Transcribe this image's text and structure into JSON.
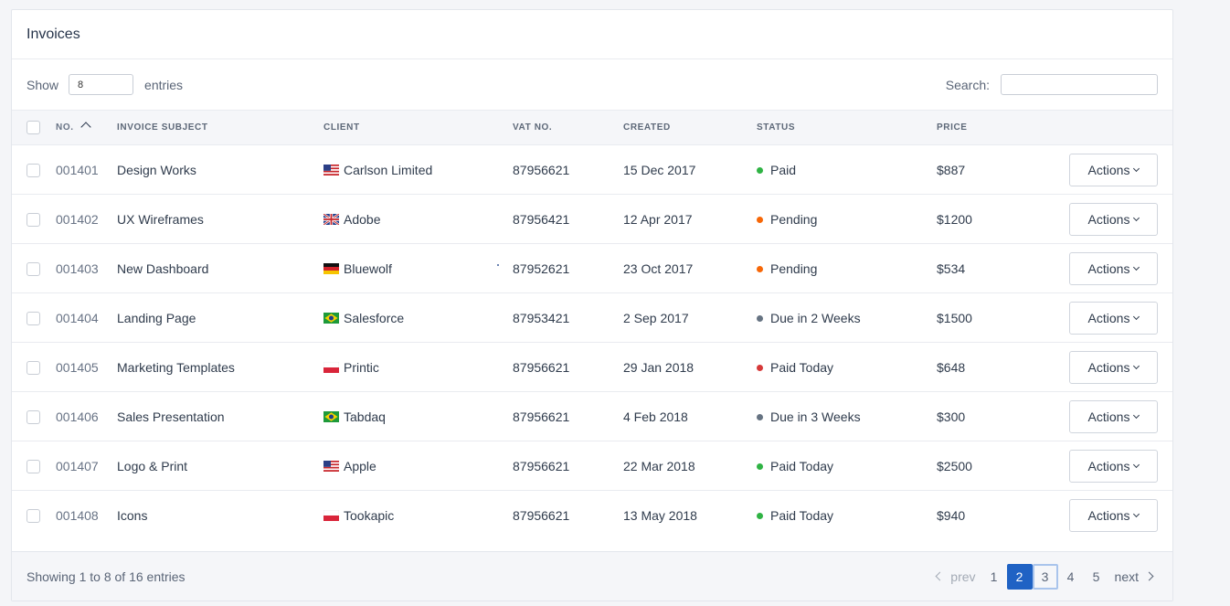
{
  "card": {
    "title": "Invoices"
  },
  "controls": {
    "show_label": "Show",
    "show_value": "8",
    "entries_label": "entries",
    "search_label": "Search:",
    "search_value": ""
  },
  "table": {
    "headers": {
      "no": "No.",
      "subject": "Invoice Subject",
      "client": "Client",
      "vat": "VAT No.",
      "created": "Created",
      "status": "Status",
      "price": "Price"
    },
    "action_label": "Actions",
    "rows": [
      {
        "no": "001401",
        "subject": "Design Works",
        "flag": "us-flag-icon",
        "client": "Carlson Limited",
        "vat": "87956621",
        "created": "15 Dec 2017",
        "status": "Paid",
        "status_color": "#2fb344",
        "price": "$887"
      },
      {
        "no": "001402",
        "subject": "UX Wireframes",
        "flag": "uk-flag-icon",
        "client": "Adobe",
        "vat": "87956421",
        "created": "12 Apr 2017",
        "status": "Pending",
        "status_color": "#f76707",
        "price": "$1200"
      },
      {
        "no": "001403",
        "subject": "New Dashboard",
        "flag": "de-flag-icon",
        "client": "Bluewolf",
        "vat": "87952621",
        "created": "23 Oct 2017",
        "status": "Pending",
        "status_color": "#f76707",
        "price": "$534"
      },
      {
        "no": "001404",
        "subject": "Landing Page",
        "flag": "br-flag-icon",
        "client": "Salesforce",
        "vat": "87953421",
        "created": "2 Sep 2017",
        "status": "Due in 2 Weeks",
        "status_color": "#667382",
        "price": "$1500"
      },
      {
        "no": "001405",
        "subject": "Marketing Templates",
        "flag": "pl-flag-icon",
        "client": "Printic",
        "vat": "87956621",
        "created": "29 Jan 2018",
        "status": "Paid Today",
        "status_color": "#d63939",
        "price": "$648"
      },
      {
        "no": "001406",
        "subject": "Sales Presentation",
        "flag": "br-flag-icon",
        "client": "Tabdaq",
        "vat": "87956621",
        "created": "4 Feb 2018",
        "status": "Due in 3 Weeks",
        "status_color": "#667382",
        "price": "$300"
      },
      {
        "no": "001407",
        "subject": "Logo & Print",
        "flag": "us-flag-icon",
        "client": "Apple",
        "vat": "87956621",
        "created": "22 Mar 2018",
        "status": "Paid Today",
        "status_color": "#2fb344",
        "price": "$2500"
      },
      {
        "no": "001408",
        "subject": "Icons",
        "flag": "pl-flag-icon",
        "client": "Tookapic",
        "vat": "87956621",
        "created": "13 May 2018",
        "status": "Paid Today",
        "status_color": "#2fb344",
        "price": "$940"
      }
    ]
  },
  "footer": {
    "summary": "Showing 1 to 8 of 16 entries",
    "prev": "prev",
    "next": "next",
    "pages": [
      "1",
      "2",
      "3",
      "4",
      "5"
    ],
    "active_page": "2"
  },
  "colors": {
    "accent": "#1f62c4",
    "paid": "#2fb344",
    "pending": "#f76707",
    "due": "#667382",
    "danger": "#d63939"
  }
}
